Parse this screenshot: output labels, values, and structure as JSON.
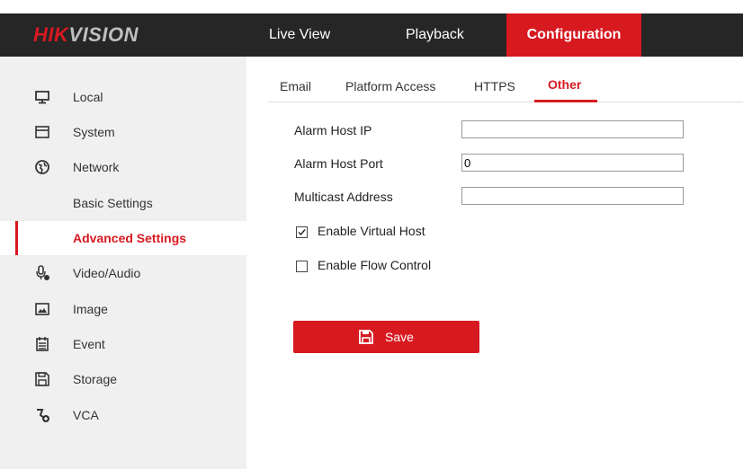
{
  "header": {
    "logo_hik": "HIK",
    "logo_vision": "VISION",
    "nav": [
      "Live View",
      "Playback",
      "Configuration"
    ]
  },
  "sidebar": {
    "items": [
      {
        "label": "Local",
        "icon": "monitor-icon"
      },
      {
        "label": "System",
        "icon": "system-window-icon"
      },
      {
        "label": "Network",
        "icon": "globe-icon"
      },
      {
        "label": "Basic Settings"
      },
      {
        "label": "Advanced Settings",
        "active": true
      },
      {
        "label": "Video/Audio",
        "icon": "microphone-icon"
      },
      {
        "label": "Image",
        "icon": "image-icon"
      },
      {
        "label": "Event",
        "icon": "calendar-icon"
      },
      {
        "label": "Storage",
        "icon": "floppy-disk-icon"
      },
      {
        "label": "VCA",
        "icon": "vca-icon"
      }
    ]
  },
  "tabs": [
    "Email",
    "Platform Access",
    "HTTPS",
    "Other"
  ],
  "form": {
    "alarm_host_ip": {
      "label": "Alarm Host IP",
      "value": ""
    },
    "alarm_host_port": {
      "label": "Alarm Host Port",
      "value": "0"
    },
    "multicast_address": {
      "label": "Multicast Address",
      "value": ""
    },
    "enable_virtual_host": {
      "label": "Enable Virtual Host",
      "checked": true
    },
    "enable_flow_control": {
      "label": "Enable Flow Control",
      "checked": false
    }
  },
  "save_label": "Save",
  "colors": {
    "accent": "#d71920",
    "topbar": "#262626",
    "sidebar": "#f0f0f0"
  }
}
